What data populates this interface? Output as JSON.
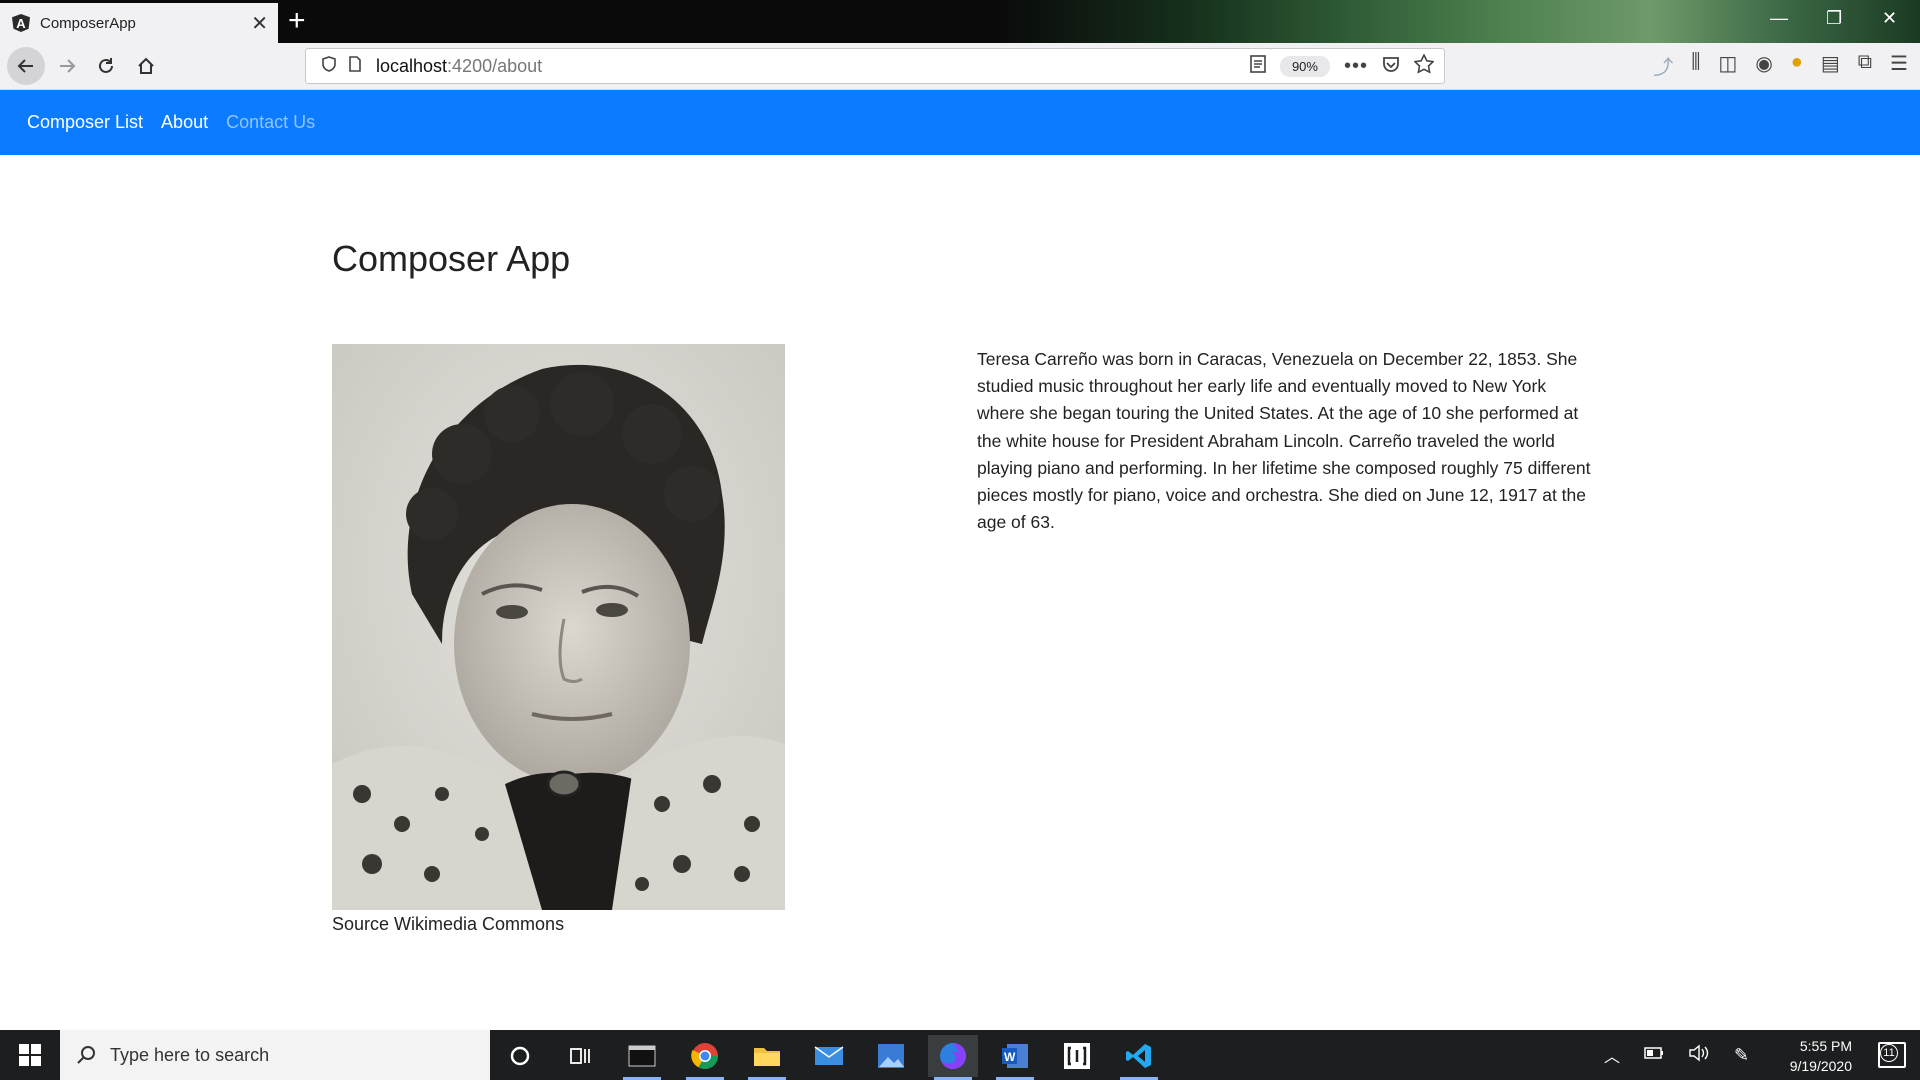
{
  "browser": {
    "tab_title": "ComposerApp",
    "tab_favicon": "A",
    "url_host": "localhost",
    "url_path": ":4200/about",
    "zoom": "90%"
  },
  "app": {
    "nav": [
      {
        "label": "Composer List"
      },
      {
        "label": "About"
      },
      {
        "label": "Contact Us"
      }
    ],
    "title": "Composer App",
    "image_caption": "Source Wikimedia Commons",
    "bio": "Teresa Carreño was born in Caracas, Venezuela on December 22, 1853. She studied music throughout her early life and eventually moved to New York where she began touring the United States. At the age of 10 she performed at the white house for President Abraham Lincoln. Carreño traveled the world playing piano and performing. In her lifetime she composed roughly 75 different pieces mostly for piano, voice and orchestra. She died on June 12, 1917 at the age of 63."
  },
  "taskbar": {
    "search_placeholder": "Type here to search",
    "time": "5:55 PM",
    "date": "9/19/2020",
    "notification_count": "11"
  },
  "colors": {
    "app_nav": "#0d7bff"
  }
}
